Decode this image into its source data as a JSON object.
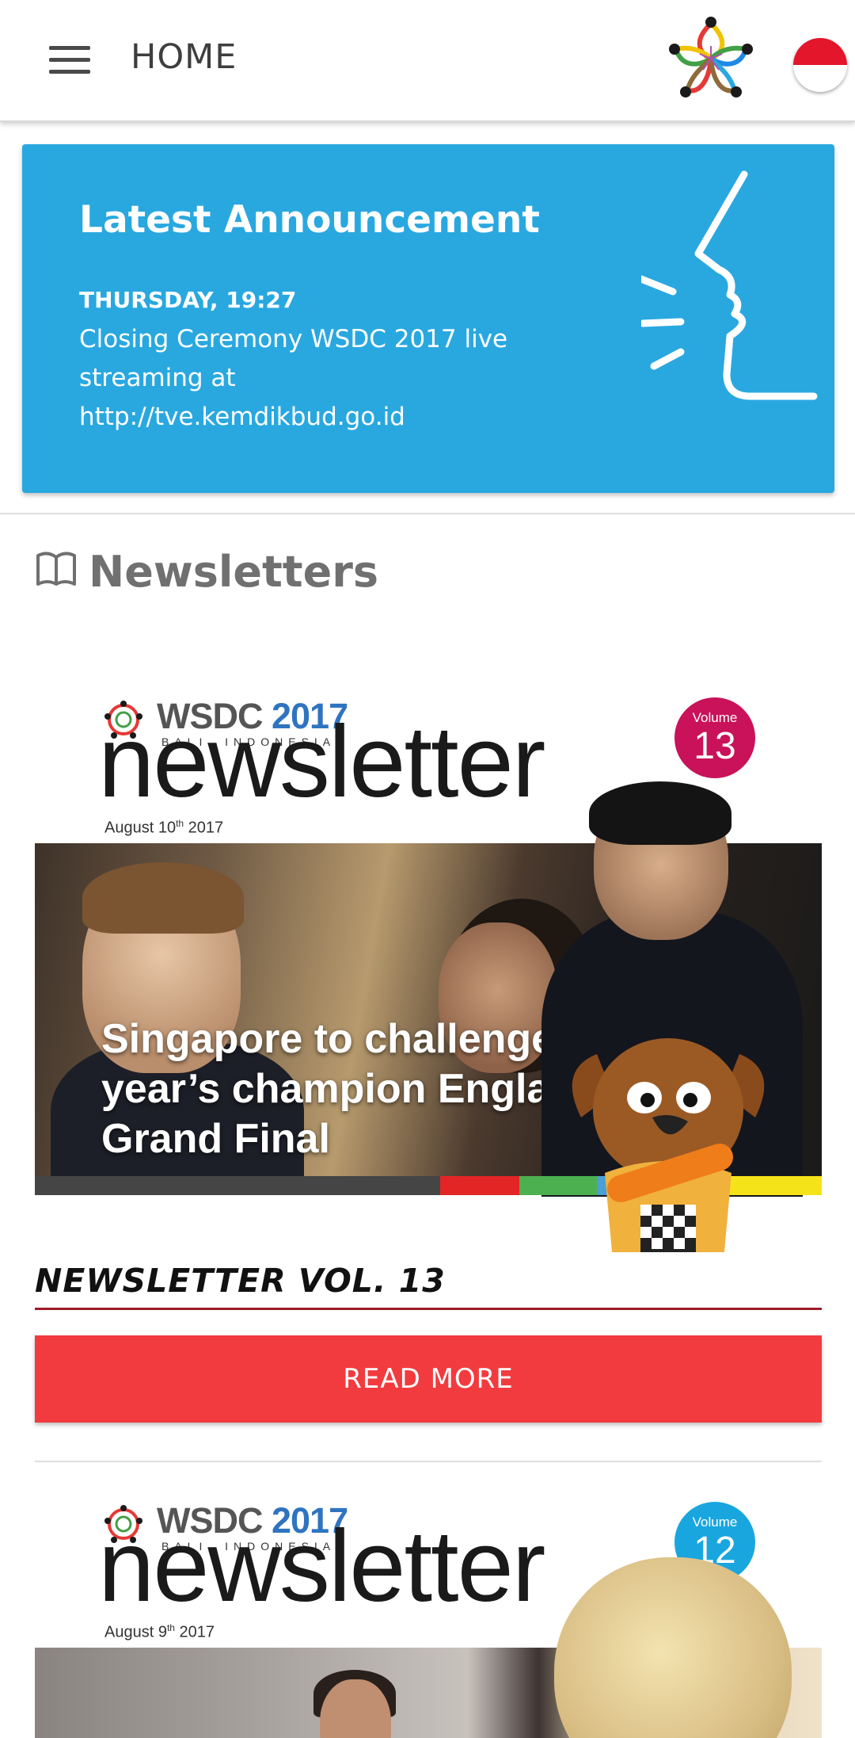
{
  "topbar": {
    "title": "HOME",
    "menu_icon": "hamburger-menu-icon",
    "logo": "wsdc-flower-logo",
    "language_flag": "indonesia-flag-icon"
  },
  "announcement": {
    "title": "Latest Announcement",
    "time": "THURSDAY, 19:27",
    "body": "Closing Ceremony WSDC 2017 live streaming at http://tve.kemdikbud.go.id",
    "icon": "speaking-face-icon",
    "background_color": "#29a8e0"
  },
  "newsletters": {
    "heading": "Newsletters",
    "heading_icon": "open-book-icon",
    "items": [
      {
        "cover": {
          "event_name": "WSDC",
          "event_year": "2017",
          "location": "BALI, INDONESIA",
          "wordmark": "newsletter",
          "date_main": "August 10",
          "date_sup": "th",
          "date_year": "2017",
          "volume_label": "Volume",
          "volume_number": "13",
          "volume_color": "#c9125a",
          "headline": "Singapore to challenge last year’s champion England in Grand Final"
        },
        "title": "NEWSLETTER VOL. 13",
        "button_label": "READ MORE"
      },
      {
        "cover": {
          "event_name": "WSDC",
          "event_year": "2017",
          "location": "BALI, INDONESIA",
          "wordmark": "newsletter",
          "date_main": "August 9",
          "date_sup": "th",
          "date_year": "2017",
          "volume_label": "Volume",
          "volume_number": "12",
          "volume_color": "#19a6df"
        }
      }
    ]
  },
  "colors": {
    "read_more_button": "#f23b3f",
    "title_rule": "#9e1b26",
    "heading_text": "#707070"
  }
}
